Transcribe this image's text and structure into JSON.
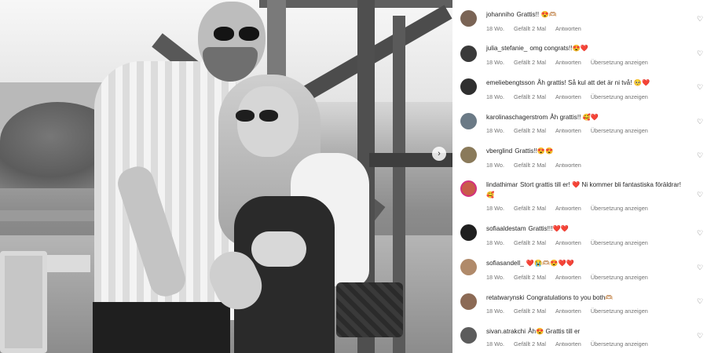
{
  "post": {
    "next_slide_icon": "chevron-right-icon"
  },
  "comments": [
    {
      "username": "johanniho",
      "text": "Grattis!! 😍🫶🏼",
      "time": "18 Wo.",
      "likes": "Gefällt 2 Mal",
      "reply": "Antworten",
      "translate": "",
      "avatar_color": "#7a6455"
    },
    {
      "username": "julia_stefanie_",
      "text": "omg congrats!!😍❤️",
      "time": "18 Wo.",
      "likes": "Gefällt 2 Mal",
      "reply": "Antworten",
      "translate": "Übersetzung anzeigen",
      "avatar_color": "#3a3a3a"
    },
    {
      "username": "emeliebengtsson",
      "text": "Åh grattis! Så kul att det är ni två! 🥺❤️",
      "time": "18 Wo.",
      "likes": "Gefällt 2 Mal",
      "reply": "Antworten",
      "translate": "Übersetzung anzeigen",
      "avatar_color": "#2f2f2f"
    },
    {
      "username": "karolinaschagerstrom",
      "text": "Åh grattis!! 🥰❤️",
      "time": "18 Wo.",
      "likes": "Gefällt 2 Mal",
      "reply": "Antworten",
      "translate": "Übersetzung anzeigen",
      "avatar_color": "#6b7a86"
    },
    {
      "username": "vberglind",
      "text": "Grattis!!😍😍",
      "time": "18 Wo.",
      "likes": "Gefällt 2 Mal",
      "reply": "Antworten",
      "translate": "",
      "avatar_color": "#8a7a5a"
    },
    {
      "username": "lindathimar",
      "text": "Stort grattis till er! ❤️ Ni kommer bli fantastiska föräldrar! 🥰",
      "time": "18 Wo.",
      "likes": "Gefällt 2 Mal",
      "reply": "Antworten",
      "translate": "Übersetzung anzeigen",
      "avatar_color": "#c95b4a"
    },
    {
      "username": "sofiaaldestam",
      "text": "Grattis!!!❤️❤️",
      "time": "18 Wo.",
      "likes": "Gefällt 2 Mal",
      "reply": "Antworten",
      "translate": "Übersetzung anzeigen",
      "avatar_color": "#1f1f1f"
    },
    {
      "username": "sofiasandell_",
      "text": "❤️😭🫶🏼😍❤️❤️",
      "time": "18 Wo.",
      "likes": "Gefällt 2 Mal",
      "reply": "Antworten",
      "translate": "Übersetzung anzeigen",
      "avatar_color": "#b08a6a"
    },
    {
      "username": "retatwarynski",
      "text": "Congratulations to you both🫶🏼",
      "time": "18 Wo.",
      "likes": "Gefällt 2 Mal",
      "reply": "Antworten",
      "translate": "Übersetzung anzeigen",
      "avatar_color": "#8c6a55"
    },
    {
      "username": "sivan.atrakchi",
      "text": "Åh😍 Grattis till er",
      "time": "18 Wo.",
      "likes": "Gefällt 2 Mal",
      "reply": "Antworten",
      "translate": "Übersetzung anzeigen",
      "avatar_color": "#5c5c5c"
    }
  ],
  "like_icon": "heart-outline-icon"
}
